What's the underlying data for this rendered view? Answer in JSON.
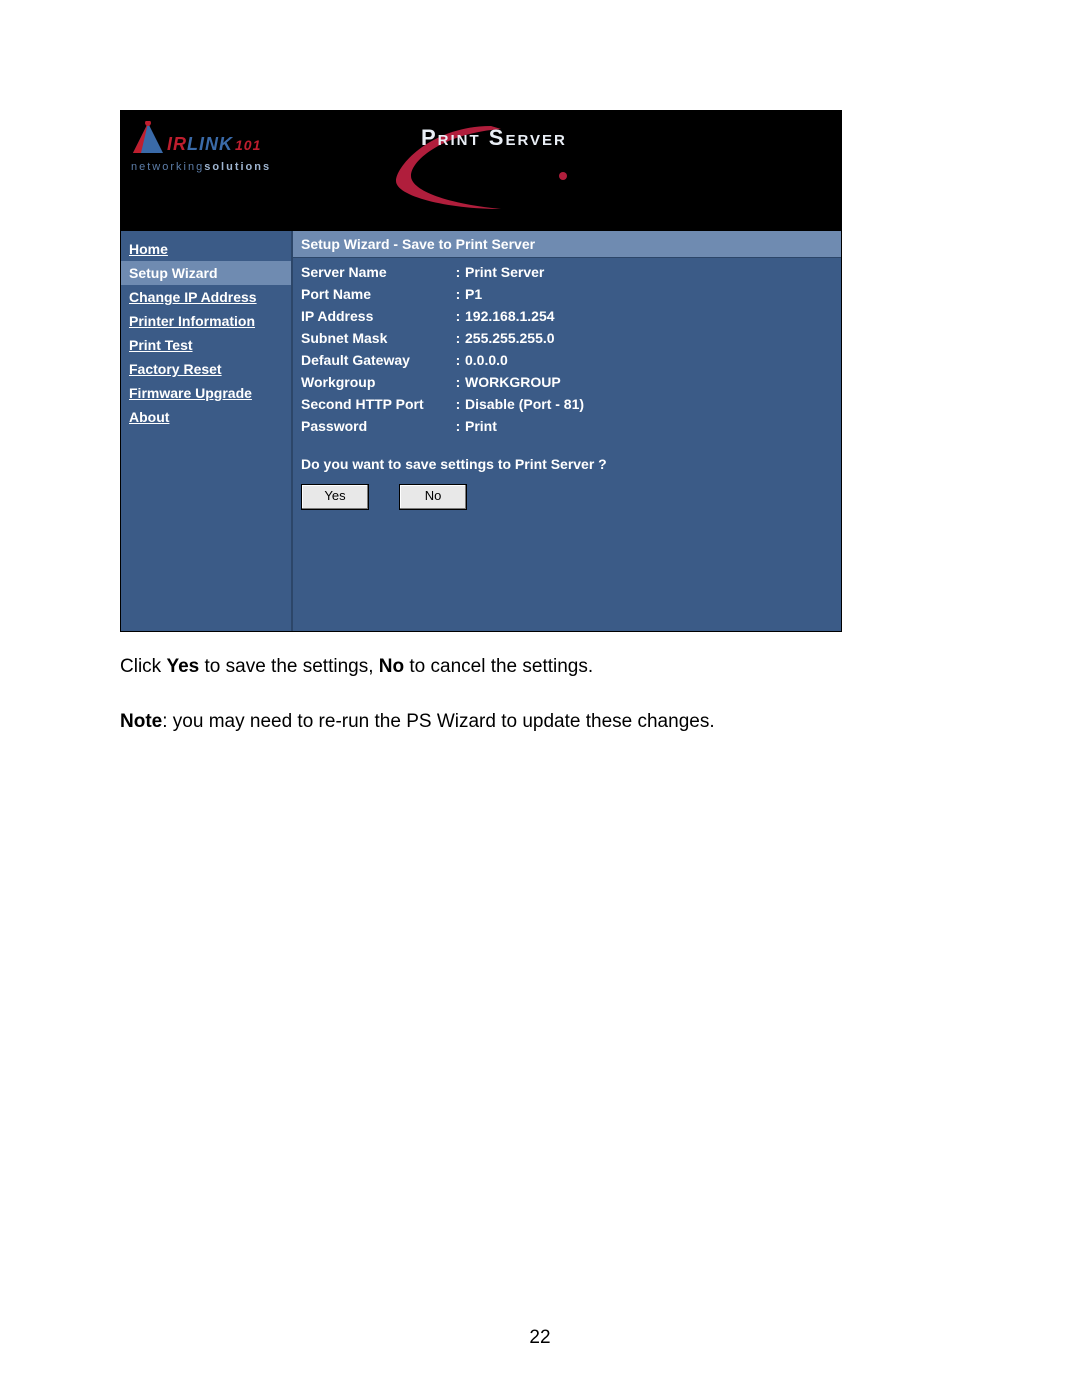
{
  "logo": {
    "brand_pre": "IR",
    "brand_post": "LINK",
    "brand_num": "101",
    "subtitle_a": "networking",
    "subtitle_b": "solutions"
  },
  "header": {
    "title": "Print Server"
  },
  "sidebar": {
    "items": [
      {
        "label": "Home",
        "selected": false
      },
      {
        "label": "Setup Wizard",
        "selected": true
      },
      {
        "label": "Change IP Address",
        "selected": false
      },
      {
        "label": "Printer Information",
        "selected": false
      },
      {
        "label": "Print Test",
        "selected": false
      },
      {
        "label": "Factory Reset",
        "selected": false
      },
      {
        "label": "Firmware Upgrade",
        "selected": false
      },
      {
        "label": "About",
        "selected": false
      }
    ]
  },
  "panel": {
    "title": "Setup Wizard - Save to Print Server",
    "rows": [
      {
        "label": "Server Name",
        "value": "Print Server"
      },
      {
        "label": "Port Name",
        "value": "P1"
      },
      {
        "label": "IP Address",
        "value": "192.168.1.254"
      },
      {
        "label": "Subnet Mask",
        "value": "255.255.255.0"
      },
      {
        "label": "Default Gateway",
        "value": "0.0.0.0"
      },
      {
        "label": "Workgroup",
        "value": "WORKGROUP"
      },
      {
        "label": "Second HTTP Port",
        "value": "Disable (Port - 81)"
      },
      {
        "label": "Password",
        "value": "Print"
      }
    ],
    "prompt": "Do you want to save settings to Print Server ?",
    "yes": "Yes",
    "no": "No"
  },
  "instructions": {
    "line1_a": "Click ",
    "line1_b": "Yes",
    "line1_c": " to save the settings, ",
    "line1_d": "No",
    "line1_e": " to cancel the settings.",
    "line2_a": "Note",
    "line2_b": ": you may need to re-run the PS Wizard to update these changes."
  },
  "page_number": "22"
}
